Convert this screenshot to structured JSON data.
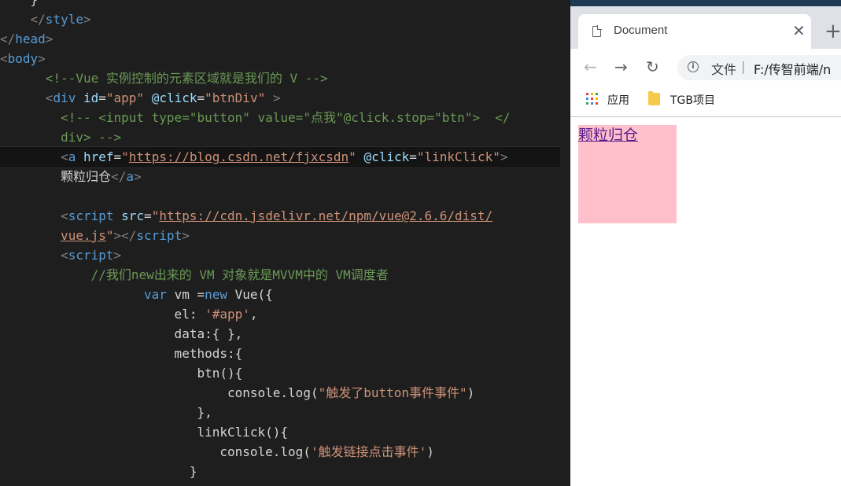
{
  "editor": {
    "lines": [
      [
        {
          "c": "tx",
          "t": "    }"
        }
      ],
      [
        {
          "c": "tx",
          "t": "    "
        },
        {
          "c": "bracket",
          "t": "</"
        },
        {
          "c": "tag",
          "t": "style"
        },
        {
          "c": "bracket",
          "t": ">"
        }
      ],
      [
        {
          "c": "bracket",
          "t": "</"
        },
        {
          "c": "tag",
          "t": "head"
        },
        {
          "c": "bracket",
          "t": ">"
        }
      ],
      [
        {
          "c": "bracket",
          "t": "<"
        },
        {
          "c": "tag",
          "t": "body"
        },
        {
          "c": "bracket",
          "t": ">"
        }
      ],
      [
        {
          "c": "tx",
          "t": "      "
        },
        {
          "c": "cm",
          "t": "<!--Vue 实例控制的元素区域就是我们的 V -->"
        }
      ],
      [
        {
          "c": "tx",
          "t": "      "
        },
        {
          "c": "bracket",
          "t": "<"
        },
        {
          "c": "tag",
          "t": "div"
        },
        {
          "c": "tx",
          "t": " "
        },
        {
          "c": "attr",
          "t": "id"
        },
        {
          "c": "tx",
          "t": "="
        },
        {
          "c": "str",
          "t": "\"app\""
        },
        {
          "c": "tx",
          "t": " "
        },
        {
          "c": "attr",
          "t": "@click"
        },
        {
          "c": "tx",
          "t": "="
        },
        {
          "c": "str",
          "t": "\"btnDiv\""
        },
        {
          "c": "tx",
          "t": " "
        },
        {
          "c": "bracket",
          "t": ">"
        }
      ],
      [
        {
          "c": "tx",
          "t": "        "
        },
        {
          "c": "cm",
          "t": "<!-- <input type=\"button\" value=\"点我\"@click.stop=\"btn\">  </"
        }
      ],
      [
        {
          "c": "tx",
          "t": "        "
        },
        {
          "c": "cm",
          "t": "div> -->"
        }
      ],
      [
        {
          "c": "tx",
          "t": "        "
        },
        {
          "c": "bracket",
          "t": "<"
        },
        {
          "c": "tag",
          "t": "a"
        },
        {
          "c": "tx",
          "t": " "
        },
        {
          "c": "attr",
          "t": "href"
        },
        {
          "c": "tx",
          "t": "="
        },
        {
          "c": "str",
          "t": "\""
        },
        {
          "c": "url",
          "t": "https://blog.csdn.net/fjxcsdn"
        },
        {
          "c": "str",
          "t": "\""
        },
        {
          "c": "tx",
          "t": " "
        },
        {
          "c": "attr",
          "t": "@click"
        },
        {
          "c": "tx",
          "t": "="
        },
        {
          "c": "str",
          "t": "\"linkClick\""
        },
        {
          "c": "bracket",
          "t": ">"
        }
      ],
      [
        {
          "c": "tx",
          "t": "        颗粒归仓"
        },
        {
          "c": "bracket",
          "t": "</"
        },
        {
          "c": "tag",
          "t": "a"
        },
        {
          "c": "bracket",
          "t": ">"
        }
      ],
      [
        {
          "c": "tx",
          "t": ""
        }
      ],
      [
        {
          "c": "tx",
          "t": "        "
        },
        {
          "c": "bracket",
          "t": "<"
        },
        {
          "c": "tag",
          "t": "script"
        },
        {
          "c": "tx",
          "t": " "
        },
        {
          "c": "attr",
          "t": "src"
        },
        {
          "c": "tx",
          "t": "="
        },
        {
          "c": "str",
          "t": "\""
        },
        {
          "c": "url",
          "t": "https://cdn.jsdelivr.net/npm/vue@2.6.6/dist/"
        }
      ],
      [
        {
          "c": "tx",
          "t": "        "
        },
        {
          "c": "url",
          "t": "vue.js"
        },
        {
          "c": "str",
          "t": "\""
        },
        {
          "c": "bracket",
          "t": "></"
        },
        {
          "c": "tag",
          "t": "script"
        },
        {
          "c": "bracket",
          "t": ">"
        }
      ],
      [
        {
          "c": "tx",
          "t": "        "
        },
        {
          "c": "bracket",
          "t": "<"
        },
        {
          "c": "tag",
          "t": "script"
        },
        {
          "c": "bracket",
          "t": ">"
        }
      ],
      [
        {
          "c": "tx",
          "t": "            "
        },
        {
          "c": "cm",
          "t": "//我们new出来的 VM 对象就是MVVM中的 VM调度者"
        }
      ],
      [
        {
          "c": "tx",
          "t": "                   "
        },
        {
          "c": "kw",
          "t": "var"
        },
        {
          "c": "tx",
          "t": " vm ="
        },
        {
          "c": "kw",
          "t": "new"
        },
        {
          "c": "tx",
          "t": " Vue({"
        }
      ],
      [
        {
          "c": "tx",
          "t": "                       el: "
        },
        {
          "c": "str",
          "t": "'#app'"
        },
        {
          "c": "tx",
          "t": ","
        }
      ],
      [
        {
          "c": "tx",
          "t": "                       data:{ },"
        }
      ],
      [
        {
          "c": "tx",
          "t": "                       methods:{"
        }
      ],
      [
        {
          "c": "tx",
          "t": "                          btn(){"
        }
      ],
      [
        {
          "c": "tx",
          "t": "                              console.log("
        },
        {
          "c": "str",
          "t": "\"触发了button事件事件\""
        },
        {
          "c": "tx",
          "t": ")"
        }
      ],
      [
        {
          "c": "tx",
          "t": "                          },"
        }
      ],
      [
        {
          "c": "tx",
          "t": "                          linkClick(){"
        }
      ],
      [
        {
          "c": "tx",
          "t": "                             console.log("
        },
        {
          "c": "str",
          "t": "'触发链接点击事件'"
        },
        {
          "c": "tx",
          "t": ")"
        }
      ],
      [
        {
          "c": "tx",
          "t": "                         }"
        }
      ],
      [
        {
          "c": "tx",
          "t": "                       },"
        }
      ]
    ]
  },
  "browser": {
    "tab_title": "Document",
    "tab_close": "✕",
    "new_tab": "+",
    "nav": {
      "back": "←",
      "forward": "→",
      "reload": "↻"
    },
    "omnibox": {
      "info": "i",
      "chip": "文件",
      "separator": "|",
      "url": "F:/传智前端/n"
    },
    "bookmarks": {
      "apps_label": "应用",
      "folder_label": "TGB项目"
    },
    "page": {
      "link_text": "颗粒归仓",
      "box_color": "#ffc0cb"
    }
  }
}
